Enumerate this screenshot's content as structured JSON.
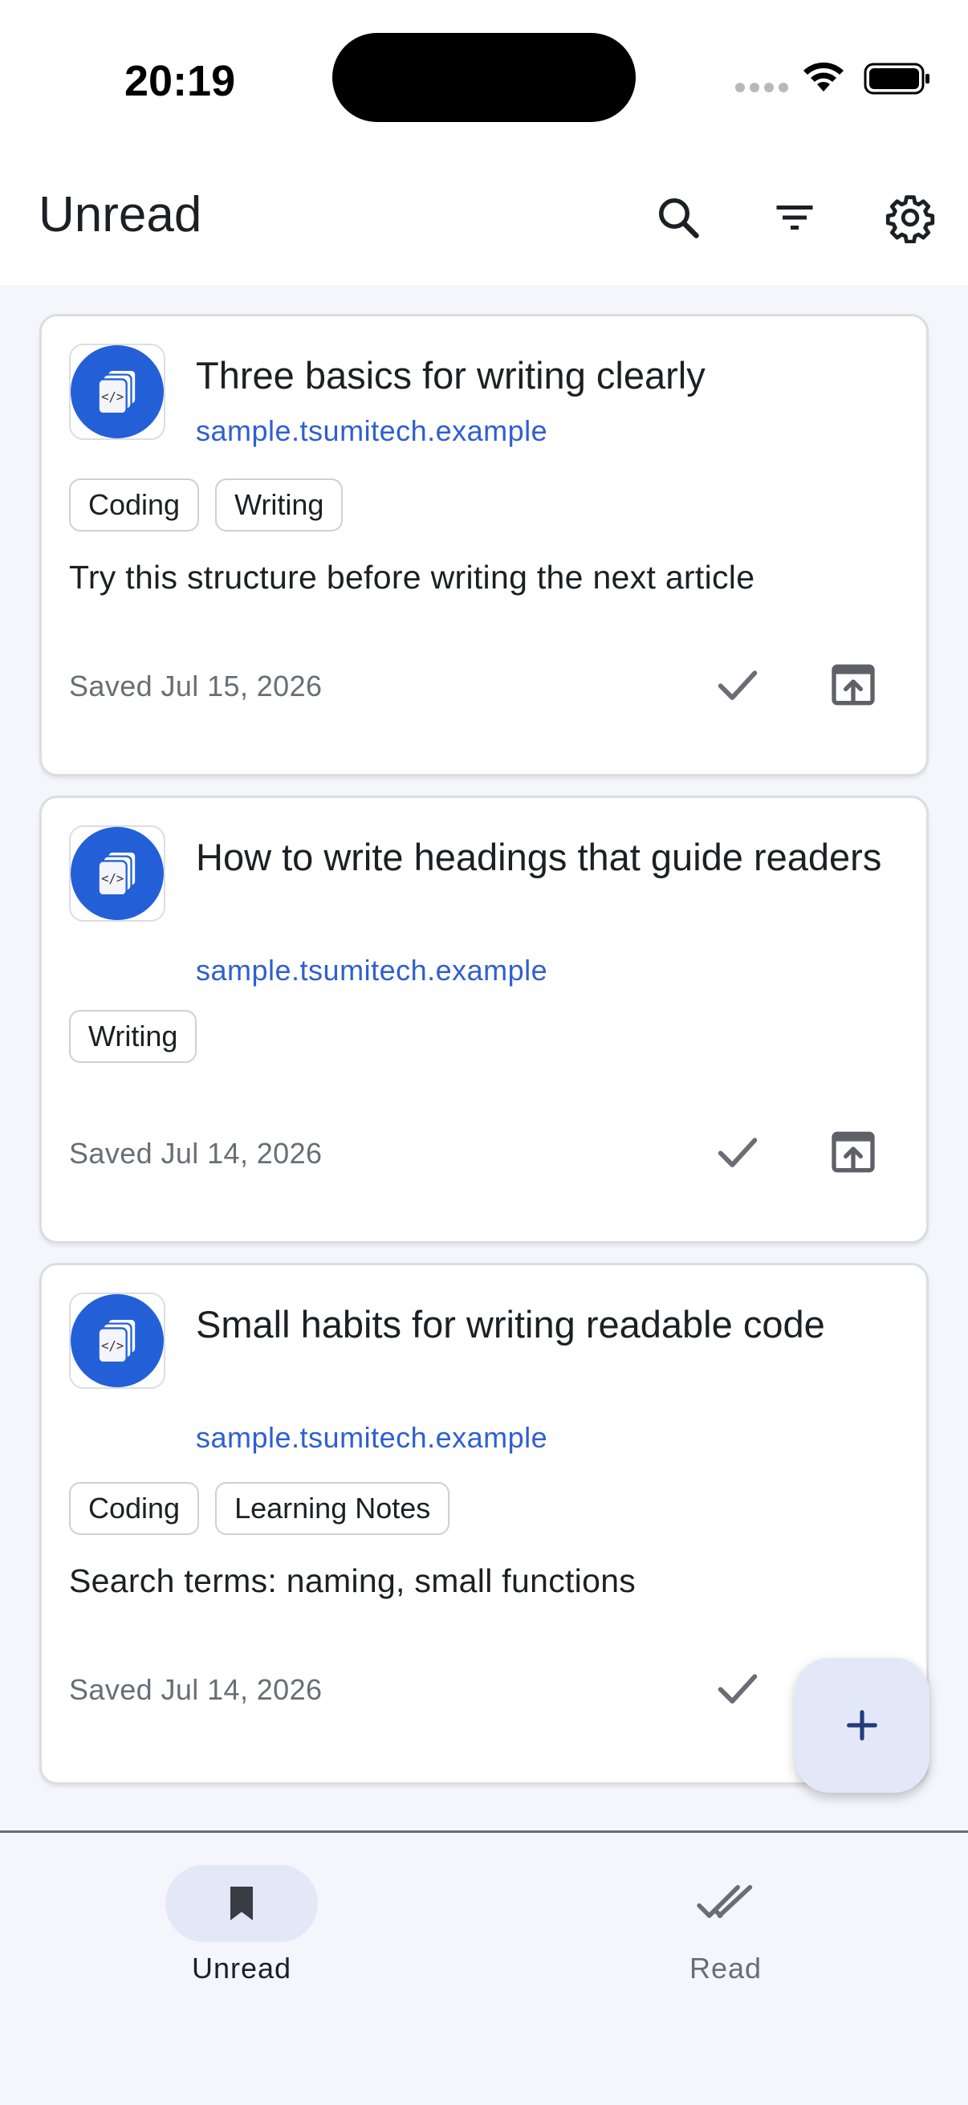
{
  "status_bar": {
    "time": "20:19"
  },
  "app_bar": {
    "title": "Unread"
  },
  "cards": [
    {
      "title": "Three basics for writing clearly",
      "domain": "sample.tsumitech.example",
      "tags": [
        "Coding",
        "Writing"
      ],
      "note": "Try this structure before writing the next article",
      "saved": "Saved Jul 15, 2026"
    },
    {
      "title": "How to write headings that guide readers",
      "domain": "sample.tsumitech.example",
      "tags": [
        "Writing"
      ],
      "note": "",
      "saved": "Saved Jul 14, 2026"
    },
    {
      "title": "Small habits for writing readable code",
      "domain": "sample.tsumitech.example",
      "tags": [
        "Coding",
        "Learning Notes"
      ],
      "note": "Search terms: naming, small functions",
      "saved": "Saved Jul 14, 2026"
    }
  ],
  "bottom_nav": {
    "items": [
      {
        "label": "Unread",
        "icon": "bookmark-icon",
        "active": true
      },
      {
        "label": "Read",
        "icon": "double-check-icon",
        "active": false
      }
    ]
  },
  "colors": {
    "accent": "#2360d8",
    "link": "#2f5fcf",
    "active_pill": "#e3e8f8",
    "background": "#f5f6fb"
  }
}
